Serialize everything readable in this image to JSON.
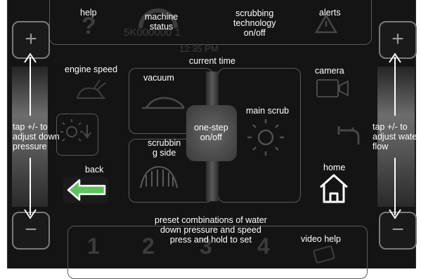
{
  "header": {
    "help": "help",
    "machine_status": "machine\nstatus",
    "scrubbing_tech": "scrubbing\ntechnology\non/off",
    "alerts": "alerts",
    "serial_faint": "5K000000 1",
    "help_glyph": "?"
  },
  "time": {
    "faint_value": "12:35 PM",
    "label": "current time"
  },
  "left_column": {
    "engine_speed": "engine speed",
    "down_pressure_hint": "tap +/- to\nadjust down\npressure",
    "back": "back"
  },
  "right_column": {
    "camera": "camera",
    "water_flow_hint": "tap +/- to\nadjust water\nflow",
    "home": "home"
  },
  "center": {
    "vacuum": "vacuum",
    "main_scrub": "main scrub",
    "scrubbing_side": "scrubbin\ng side",
    "one_step": "one-step\non/off"
  },
  "steppers": {
    "plus": "+",
    "minus": "−"
  },
  "footer": {
    "presets_hint": "preset combinations of water\ndown pressure and speed\npress and hold to set",
    "video_help": "video help",
    "presets": [
      "1",
      "2",
      "3",
      "4"
    ]
  },
  "colors": {
    "back_arrow": "#5ec25e",
    "panel": "#141414",
    "annotation": "#ffffff"
  }
}
